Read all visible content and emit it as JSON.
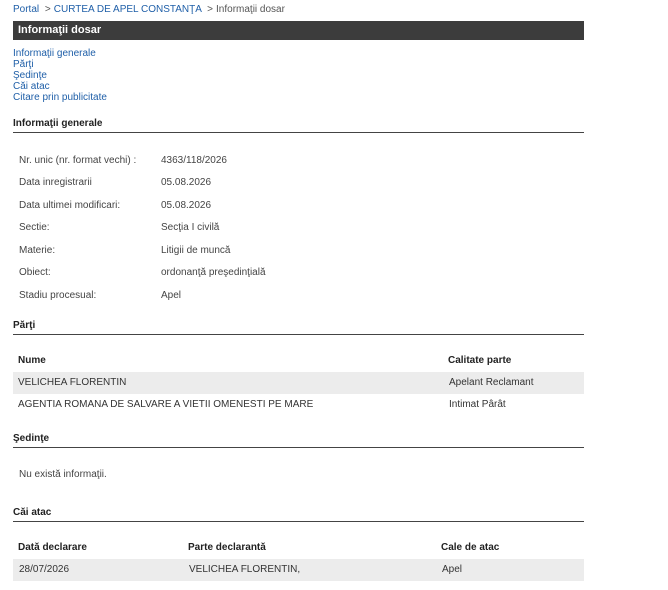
{
  "breadcrumb": {
    "portal": "Portal",
    "court": "CURTEA DE APEL CONSTANŢA",
    "current": "Informaţii dosar",
    "separator": ">"
  },
  "title": "Informaţii dosar",
  "nav": [
    "Informaţii generale",
    "Părţi",
    "Şedinţe",
    "Căi atac",
    "Citare prin publicitate"
  ],
  "general": {
    "heading": "Informaţii generale",
    "rows": [
      {
        "label": "Nr. unic (nr. format vechi) :",
        "value": "4363/118/2026"
      },
      {
        "label": "Data inregistrarii",
        "value": "05.08.2026"
      },
      {
        "label": "Data ultimei modificari:",
        "value": "05.08.2026"
      },
      {
        "label": "Sectie:",
        "value": "Secţia I civilă"
      },
      {
        "label": "Materie:",
        "value": "Litigii de muncă"
      },
      {
        "label": "Obiect:",
        "value": "ordonanţă preşedinţială"
      },
      {
        "label": "Stadiu procesual:",
        "value": "Apel"
      }
    ]
  },
  "parti": {
    "heading": "Părţi",
    "headers": [
      "Nume",
      "Calitate parte"
    ],
    "rows": [
      [
        "VELICHEA FLORENTIN",
        "Apelant Reclamant"
      ],
      [
        "AGENTIA ROMANA DE SALVARE A VIETII OMENESTI PE MARE",
        "Intimat Pârât"
      ]
    ]
  },
  "sedinte": {
    "heading": "Şedinţe",
    "empty": "Nu există informaţii."
  },
  "cai_atac": {
    "heading": "Căi atac",
    "headers": [
      "Dată declarare",
      "Parte declarantă",
      "Cale de atac"
    ],
    "rows": [
      [
        "28/07/2026",
        "VELICHEA FLORENTIN,",
        "Apel"
      ]
    ]
  }
}
